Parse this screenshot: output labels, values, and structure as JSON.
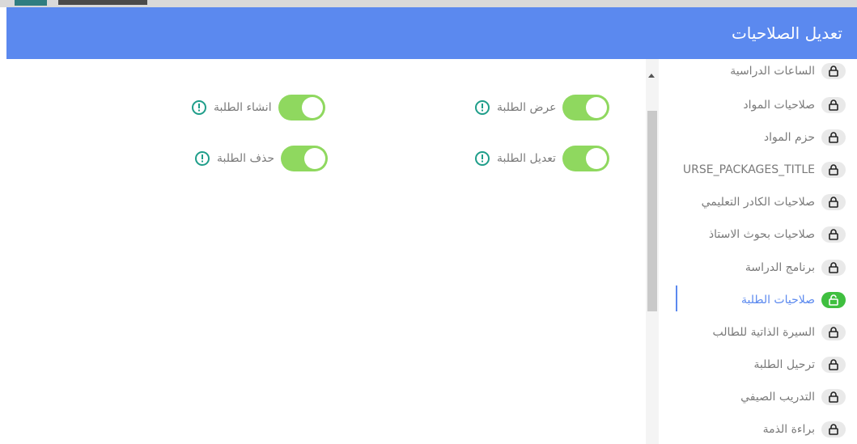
{
  "modal": {
    "title": "تعديل الصلاحيات"
  },
  "sidebar": {
    "items": [
      {
        "label": "الساعات الدراسية",
        "active": false
      },
      {
        "label": "صلاحيات المواد",
        "active": false
      },
      {
        "label": "حزم المواد",
        "active": false
      },
      {
        "label": "URSE_PACKAGES_TITLE",
        "active": false
      },
      {
        "label": "صلاحيات الكادر التعليمي",
        "active": false
      },
      {
        "label": "صلاحيات بحوث الاستاذ",
        "active": false
      },
      {
        "label": "برنامج الدراسة",
        "active": false
      },
      {
        "label": "صلاحيات الطلبة",
        "active": true
      },
      {
        "label": "السيرة الذاتية للطالب",
        "active": false
      },
      {
        "label": "ترحيل الطلبة",
        "active": false
      },
      {
        "label": "التدريب الصيفي",
        "active": false
      },
      {
        "label": "براءة الذمة",
        "active": false
      }
    ]
  },
  "permissions": [
    {
      "label": "عرض الطلبة",
      "enabled": true
    },
    {
      "label": "انشاء الطلبة",
      "enabled": true
    },
    {
      "label": "تعديل الطلبة",
      "enabled": true
    },
    {
      "label": "حذف الطلبة",
      "enabled": true
    }
  ],
  "colors": {
    "header": "#5b89ef",
    "toggle_on": "#8fd85f",
    "active_lock": "#3fbf3f",
    "info_icon": "#1f9e8a"
  },
  "icons": {
    "lock": "lock-icon",
    "unlock": "unlock-icon",
    "info": "info-circle-icon"
  }
}
